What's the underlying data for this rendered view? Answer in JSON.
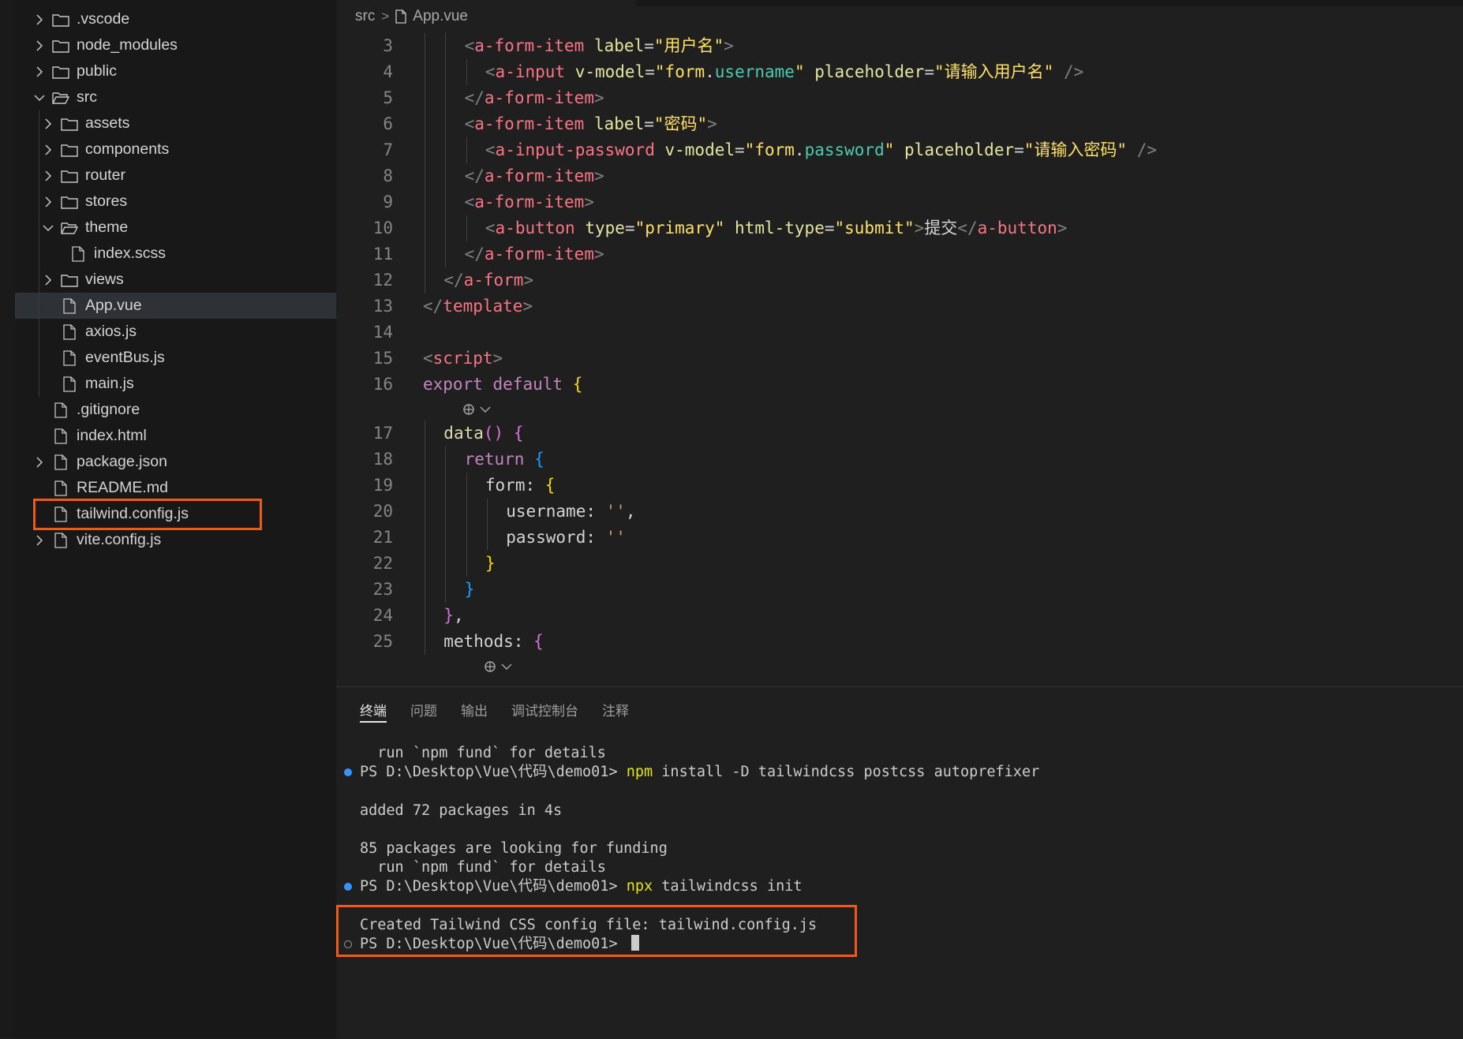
{
  "explorer": {
    "items": [
      {
        "label": ".vscode",
        "kind": "folder",
        "expanded": false,
        "depth": 0
      },
      {
        "label": "node_modules",
        "kind": "folder",
        "expanded": false,
        "depth": 0
      },
      {
        "label": "public",
        "kind": "folder",
        "expanded": false,
        "depth": 0
      },
      {
        "label": "src",
        "kind": "folder",
        "expanded": true,
        "depth": 0
      },
      {
        "label": "assets",
        "kind": "folder",
        "expanded": false,
        "depth": 1
      },
      {
        "label": "components",
        "kind": "folder",
        "expanded": false,
        "depth": 1
      },
      {
        "label": "router",
        "kind": "folder",
        "expanded": false,
        "depth": 1
      },
      {
        "label": "stores",
        "kind": "folder",
        "expanded": false,
        "depth": 1
      },
      {
        "label": "theme",
        "kind": "folder",
        "expanded": true,
        "depth": 1
      },
      {
        "label": "index.scss",
        "kind": "file",
        "depth": 2
      },
      {
        "label": "views",
        "kind": "folder",
        "expanded": false,
        "depth": 1
      },
      {
        "label": "App.vue",
        "kind": "file",
        "depth": 1,
        "selected": true
      },
      {
        "label": "axios.js",
        "kind": "file",
        "depth": 1
      },
      {
        "label": "eventBus.js",
        "kind": "file",
        "depth": 1
      },
      {
        "label": "main.js",
        "kind": "file",
        "depth": 1
      },
      {
        "label": ".gitignore",
        "kind": "file",
        "depth": 0
      },
      {
        "label": "index.html",
        "kind": "file",
        "depth": 0
      },
      {
        "label": "package.json",
        "kind": "file",
        "depth": 0,
        "chevron": true
      },
      {
        "label": "README.md",
        "kind": "file",
        "depth": 0
      },
      {
        "label": "tailwind.config.js",
        "kind": "file",
        "depth": 0,
        "highlighted": true
      },
      {
        "label": "vite.config.js",
        "kind": "file",
        "depth": 0,
        "chevron": true
      }
    ]
  },
  "breadcrumb": {
    "folder": "src",
    "separator": ">",
    "file": "App.vue"
  },
  "editor": {
    "lines": [
      {
        "n": "3",
        "indent": 2,
        "tokens": [
          [
            "punc",
            "<"
          ],
          [
            "tagname",
            "a-form-item"
          ],
          [
            "txt",
            " "
          ],
          [
            "attr",
            "label"
          ],
          [
            "txt",
            "="
          ],
          [
            "y",
            "\"用户名\""
          ],
          [
            "punc",
            ">"
          ]
        ]
      },
      {
        "n": "4",
        "indent": 3,
        "tokens": [
          [
            "punc",
            "<"
          ],
          [
            "tagname",
            "a-input"
          ],
          [
            "txt",
            " "
          ],
          [
            "attr",
            "v-model"
          ],
          [
            "txt",
            "="
          ],
          [
            "y",
            "\""
          ],
          [
            "y",
            "form"
          ],
          [
            "txt",
            "."
          ],
          [
            "var",
            "username"
          ],
          [
            "y",
            "\""
          ],
          [
            "txt",
            " "
          ],
          [
            "attr",
            "placeholder"
          ],
          [
            "txt",
            "="
          ],
          [
            "y",
            "\"请输入用户名\""
          ],
          [
            "txt",
            " "
          ],
          [
            "punc",
            "/>"
          ]
        ]
      },
      {
        "n": "5",
        "indent": 2,
        "tokens": [
          [
            "punc",
            "</"
          ],
          [
            "tagname",
            "a-form-item"
          ],
          [
            "punc",
            ">"
          ]
        ]
      },
      {
        "n": "6",
        "indent": 2,
        "tokens": [
          [
            "punc",
            "<"
          ],
          [
            "tagname",
            "a-form-item"
          ],
          [
            "txt",
            " "
          ],
          [
            "attr",
            "label"
          ],
          [
            "txt",
            "="
          ],
          [
            "y",
            "\"密码\""
          ],
          [
            "punc",
            ">"
          ]
        ]
      },
      {
        "n": "7",
        "indent": 3,
        "tokens": [
          [
            "punc",
            "<"
          ],
          [
            "tagname",
            "a-input-password"
          ],
          [
            "txt",
            " "
          ],
          [
            "attr",
            "v-model"
          ],
          [
            "txt",
            "="
          ],
          [
            "y",
            "\""
          ],
          [
            "y",
            "form"
          ],
          [
            "txt",
            "."
          ],
          [
            "var",
            "password"
          ],
          [
            "y",
            "\""
          ],
          [
            "txt",
            " "
          ],
          [
            "attr",
            "placeholder"
          ],
          [
            "txt",
            "="
          ],
          [
            "y",
            "\"请输入密码\""
          ],
          [
            "txt",
            " "
          ],
          [
            "punc",
            "/>"
          ]
        ]
      },
      {
        "n": "8",
        "indent": 2,
        "tokens": [
          [
            "punc",
            "</"
          ],
          [
            "tagname",
            "a-form-item"
          ],
          [
            "punc",
            ">"
          ]
        ]
      },
      {
        "n": "9",
        "indent": 2,
        "tokens": [
          [
            "punc",
            "<"
          ],
          [
            "tagname",
            "a-form-item"
          ],
          [
            "punc",
            ">"
          ]
        ]
      },
      {
        "n": "10",
        "indent": 3,
        "tokens": [
          [
            "punc",
            "<"
          ],
          [
            "tagname",
            "a-button"
          ],
          [
            "txt",
            " "
          ],
          [
            "attr",
            "type"
          ],
          [
            "txt",
            "="
          ],
          [
            "y",
            "\"primary\""
          ],
          [
            "txt",
            " "
          ],
          [
            "attr",
            "html-type"
          ],
          [
            "txt",
            "="
          ],
          [
            "y",
            "\"submit\""
          ],
          [
            "punc",
            ">"
          ],
          [
            "txt",
            "提交"
          ],
          [
            "punc",
            "</"
          ],
          [
            "tagname",
            "a-button"
          ],
          [
            "punc",
            ">"
          ]
        ]
      },
      {
        "n": "11",
        "indent": 2,
        "tokens": [
          [
            "punc",
            "</"
          ],
          [
            "tagname",
            "a-form-item"
          ],
          [
            "punc",
            ">"
          ]
        ]
      },
      {
        "n": "12",
        "indent": 1,
        "tokens": [
          [
            "punc",
            "</"
          ],
          [
            "tagname",
            "a-form"
          ],
          [
            "punc",
            ">"
          ]
        ]
      },
      {
        "n": "13",
        "indent": 0,
        "tokens": [
          [
            "punc",
            "</"
          ],
          [
            "tagname",
            "template"
          ],
          [
            "punc",
            ">"
          ]
        ]
      },
      {
        "n": "14",
        "indent": 0,
        "tokens": []
      },
      {
        "n": "15",
        "indent": 0,
        "tokens": [
          [
            "punc",
            "<"
          ],
          [
            "tagname",
            "script"
          ],
          [
            "punc",
            ">"
          ]
        ]
      },
      {
        "n": "16",
        "indent": 0,
        "tokens": [
          [
            "kw",
            "export"
          ],
          [
            "txt",
            " "
          ],
          [
            "kw",
            "default"
          ],
          [
            "txt",
            " "
          ],
          [
            "br1",
            "{"
          ]
        ]
      },
      {
        "n": "17",
        "indent": 1,
        "tokens": [
          [
            "fn",
            "data"
          ],
          [
            "br2",
            "()"
          ],
          [
            "txt",
            " "
          ],
          [
            "br2",
            "{"
          ]
        ]
      },
      {
        "n": "18",
        "indent": 2,
        "tokens": [
          [
            "kw",
            "return"
          ],
          [
            "txt",
            " "
          ],
          [
            "br3",
            "{"
          ]
        ]
      },
      {
        "n": "19",
        "indent": 3,
        "tokens": [
          [
            "txt",
            "form: "
          ],
          [
            "br1",
            "{"
          ]
        ]
      },
      {
        "n": "20",
        "indent": 4,
        "tokens": [
          [
            "txt",
            "username: "
          ],
          [
            "sq",
            "''"
          ],
          [
            "txt",
            ","
          ]
        ]
      },
      {
        "n": "21",
        "indent": 4,
        "tokens": [
          [
            "txt",
            "password: "
          ],
          [
            "sq",
            "''"
          ]
        ]
      },
      {
        "n": "22",
        "indent": 3,
        "tokens": [
          [
            "br1",
            "}"
          ]
        ]
      },
      {
        "n": "23",
        "indent": 2,
        "tokens": [
          [
            "br3",
            "}"
          ]
        ]
      },
      {
        "n": "24",
        "indent": 1,
        "tokens": [
          [
            "br2",
            "}"
          ],
          [
            "txt",
            ","
          ]
        ]
      },
      {
        "n": "25",
        "indent": 1,
        "tokens": [
          [
            "txt",
            "methods: "
          ],
          [
            "br2",
            "{"
          ]
        ]
      }
    ]
  },
  "panel": {
    "tabs": [
      "终端",
      "问题",
      "输出",
      "调试控制台",
      "注释"
    ],
    "active_tab": "终端",
    "terminal": [
      {
        "text": "  run `npm fund` for details",
        "dot": ""
      },
      {
        "prompt": "PS D:\\Desktop\\Vue\\代码\\demo01> ",
        "cmd": "npm",
        "args": " install -D tailwindcss postcss autoprefixer",
        "dot": "filled"
      },
      {
        "text": "",
        "dot": ""
      },
      {
        "text": "added 72 packages in 4s",
        "dot": ""
      },
      {
        "text": "",
        "dot": ""
      },
      {
        "text": "85 packages are looking for funding",
        "dot": ""
      },
      {
        "text": "  run `npm fund` for details",
        "dot": ""
      },
      {
        "prompt": "PS D:\\Desktop\\Vue\\代码\\demo01> ",
        "cmd": "npx",
        "args": " tailwindcss init",
        "dot": "filled"
      },
      {
        "text": "",
        "dot": ""
      },
      {
        "text": "Created Tailwind CSS config file: tailwind.config.js",
        "dot": ""
      },
      {
        "prompt": "PS D:\\Desktop\\Vue\\代码\\demo01> ",
        "cmd": "",
        "args": "",
        "dot": "hollow",
        "cursor": true
      }
    ]
  },
  "colors": {
    "highlight_box": "#f05a14",
    "dot_filled": "#3794ff",
    "command": "#e5e510"
  }
}
